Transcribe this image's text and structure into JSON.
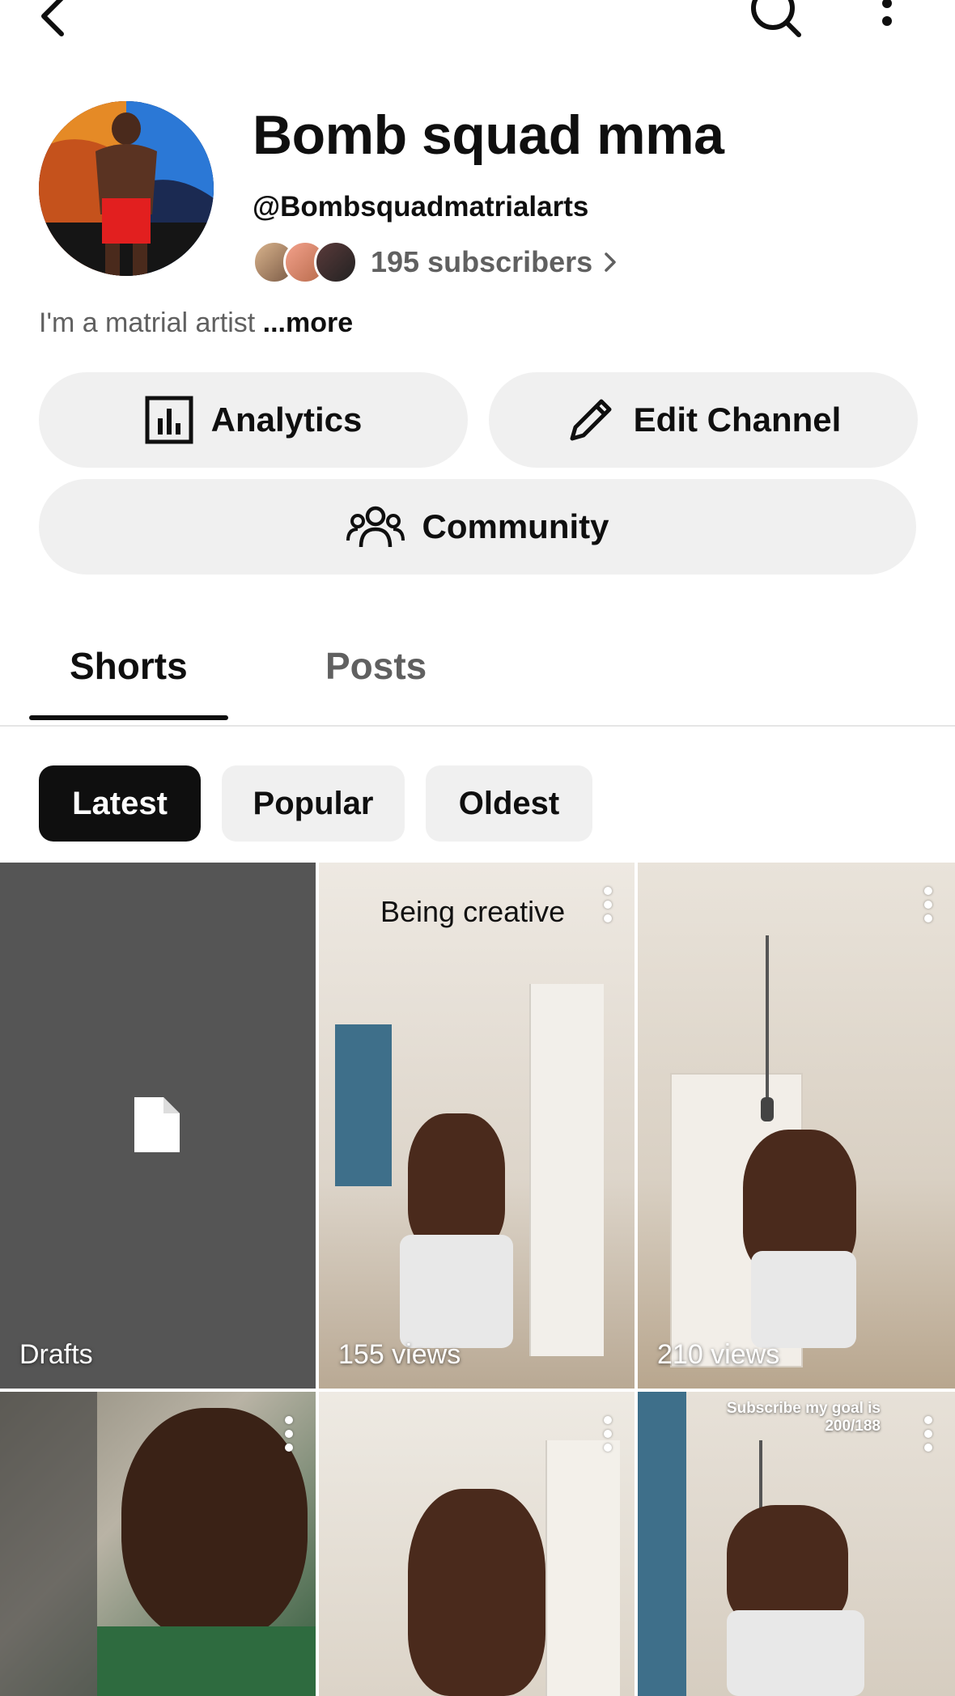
{
  "topbar": {
    "back_icon": "back-arrow-icon",
    "search_icon": "search-icon",
    "more_icon": "more-vert-icon"
  },
  "channel": {
    "name": "Bomb squad mma",
    "handle": "@Bombsquadmatrialarts",
    "subscribers": "195 subscribers",
    "bio": "I'm a matrial artist",
    "bio_more": "...more"
  },
  "actions": {
    "analytics": "Analytics",
    "edit_channel": "Edit Channel",
    "community": "Community"
  },
  "tabs": [
    {
      "label": "Shorts",
      "active": true
    },
    {
      "label": "Posts",
      "active": false
    }
  ],
  "filters": [
    {
      "label": "Latest",
      "selected": true
    },
    {
      "label": "Popular",
      "selected": false
    },
    {
      "label": "Oldest",
      "selected": false
    }
  ],
  "grid": [
    {
      "type": "drafts",
      "label": "Drafts",
      "icon": "document-icon"
    },
    {
      "type": "short",
      "views": "155 views",
      "overlay": "Being creative"
    },
    {
      "type": "short",
      "views": "210 views",
      "overlay": ""
    },
    {
      "type": "short",
      "views": "",
      "overlay": ""
    },
    {
      "type": "short",
      "views": "",
      "overlay": ""
    },
    {
      "type": "short",
      "views": "",
      "overlay": "Subscribe my goal is 200/188"
    }
  ],
  "colors": {
    "pill_bg": "#f0f0f0",
    "chip_selected_bg": "#0f0f0f",
    "chip_bg": "#f0f0f0",
    "drafts_bg": "#555555",
    "muted_text": "#606060"
  }
}
